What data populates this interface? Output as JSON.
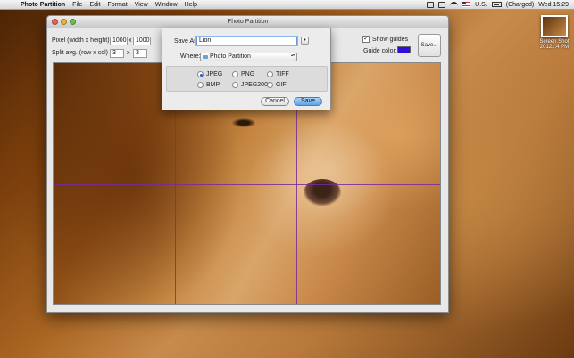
{
  "menubar": {
    "apple_glyph": "",
    "items": [
      "Photo Partition",
      "File",
      "Edit",
      "Format",
      "View",
      "Window",
      "Help"
    ],
    "status": {
      "flag": "U.S.",
      "battery": "(Charged)",
      "clock": "Wed 15:29"
    }
  },
  "desktop": {
    "icon_label_1": "Screen Shot",
    "icon_label_2": "2012...4 PM"
  },
  "window": {
    "title": "Photo Partition",
    "pixel_label": "Pixel (width x height)",
    "pixel_width": "1000",
    "pixel_height": "1000",
    "times": "x",
    "split_label": "Split avg. (row x col)",
    "split_rows": "3",
    "split_cols": "3",
    "show_guides_label": "Show guides",
    "show_guides_checked": "✓",
    "guide_color_label": "Guide color:",
    "guide_color": "#2d10d8",
    "save_button": "Save..."
  },
  "sheet": {
    "save_as_label": "Save As:",
    "save_as_value": "Lion",
    "expand_glyph": "▾",
    "where_label": "Where:",
    "where_value": "Photo Partition",
    "formats": [
      {
        "label": "JPEG",
        "selected": true
      },
      {
        "label": "PNG",
        "selected": false
      },
      {
        "label": "TIFF",
        "selected": false
      },
      {
        "label": "BMP",
        "selected": false
      },
      {
        "label": "JPEG2000",
        "selected": false
      },
      {
        "label": "GIF",
        "selected": false
      }
    ],
    "cancel_label": "Cancel",
    "save_label": "Save"
  }
}
